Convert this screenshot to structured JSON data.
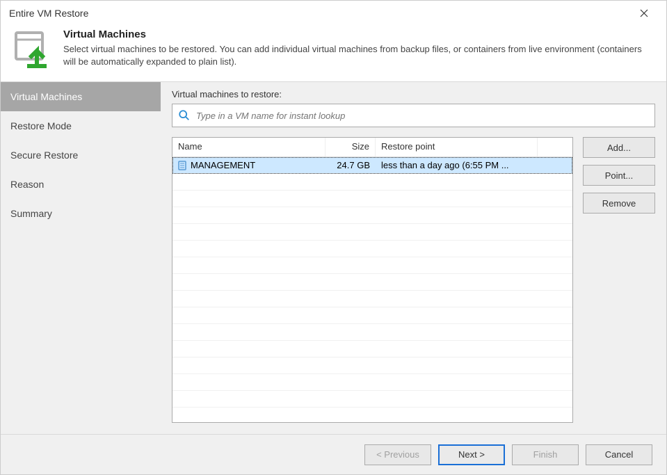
{
  "window": {
    "title": "Entire VM Restore"
  },
  "header": {
    "title": "Virtual Machines",
    "description": "Select virtual machines to be restored. You  can add individual virtual machines from backup files, or containers from live environment (containers will be automatically expanded to plain list)."
  },
  "sidebar": {
    "items": [
      {
        "label": "Virtual Machines",
        "active": true
      },
      {
        "label": "Restore Mode",
        "active": false
      },
      {
        "label": "Secure Restore",
        "active": false
      },
      {
        "label": "Reason",
        "active": false
      },
      {
        "label": "Summary",
        "active": false
      }
    ]
  },
  "main": {
    "label": "Virtual machines to restore:",
    "search_placeholder": "Type in a VM name for instant lookup",
    "columns": {
      "name": "Name",
      "size": "Size",
      "restore_point": "Restore point"
    },
    "rows": [
      {
        "name": "MANAGEMENT",
        "size": "24.7 GB",
        "restore_point": "less than a day ago (6:55 PM ..."
      }
    ],
    "buttons": {
      "add": "Add...",
      "point": "Point...",
      "remove": "Remove"
    }
  },
  "footer": {
    "previous": "< Previous",
    "next": "Next >",
    "finish": "Finish",
    "cancel": "Cancel"
  }
}
